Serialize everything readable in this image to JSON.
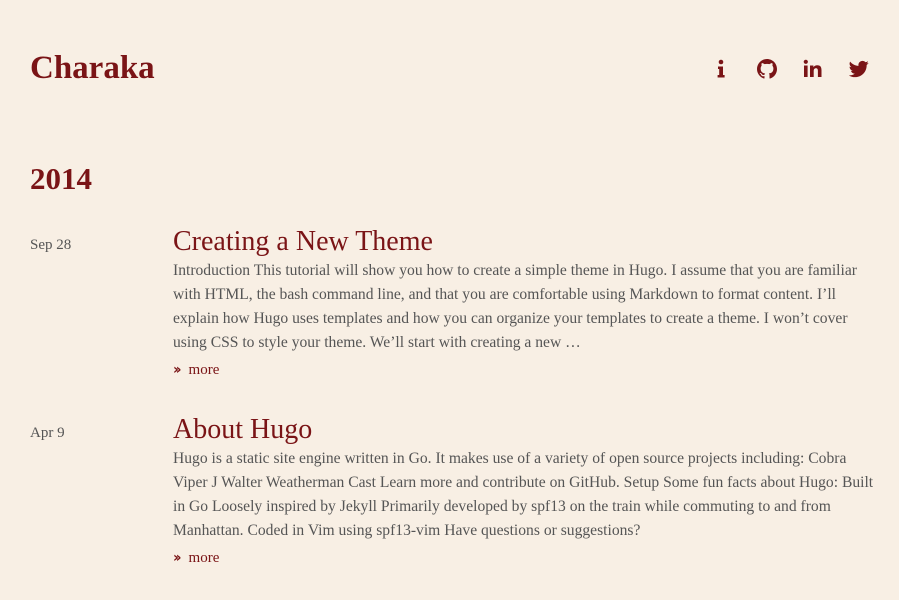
{
  "site": {
    "title": "Charaka"
  },
  "social": [
    {
      "icon": "info-icon"
    },
    {
      "icon": "github-icon"
    },
    {
      "icon": "linkedin-icon"
    },
    {
      "icon": "twitter-icon"
    }
  ],
  "archive": {
    "year": "2014",
    "posts": [
      {
        "date": "Sep 28",
        "title": "Creating a New Theme",
        "summary": "Introduction This tutorial will show you how to create a simple theme in Hugo. I assume that you are familiar with HTML, the bash command line, and that you are comfortable using Markdown to format content. I’ll explain how Hugo uses templates and how you can organize your templates to create a theme. I won’t cover using CSS to style your theme. We’ll start with creating a new …",
        "more_label": "more"
      },
      {
        "date": "Apr 9",
        "title": "About Hugo",
        "summary": "Hugo is a static site engine written in Go. It makes use of a variety of open source projects including: Cobra Viper J Walter Weatherman Cast Learn more and contribute on GitHub. Setup Some fun facts about Hugo: Built in Go Loosely inspired by Jekyll Primarily developed by spf13 on the train while commuting to and from Manhattan. Coded in Vim using spf13-vim Have questions or suggestions?",
        "more_label": "more"
      }
    ]
  },
  "colors": {
    "background": "#f8efe4",
    "accent": "#7a1416",
    "text": "#555555"
  }
}
